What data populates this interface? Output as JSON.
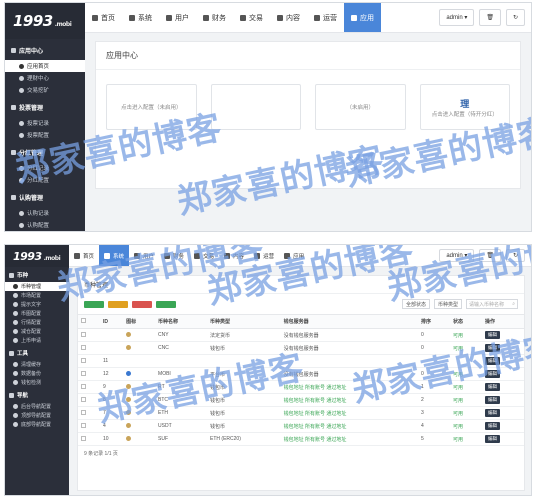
{
  "brand": {
    "logo": "1993",
    "logo_suffix": ".mobi"
  },
  "nav_tabs": [
    {
      "label": "首页",
      "icon": "home-icon"
    },
    {
      "label": "系统",
      "icon": "gear-icon"
    },
    {
      "label": "用户",
      "icon": "user-icon"
    },
    {
      "label": "财务",
      "icon": "list-icon"
    },
    {
      "label": "交易",
      "icon": "exchange-icon"
    },
    {
      "label": "内容",
      "icon": "document-icon"
    },
    {
      "label": "运营",
      "icon": "globe-icon"
    },
    {
      "label": "应用",
      "icon": "grid-icon"
    }
  ],
  "top_right": {
    "user": "admin ▾",
    "trash": "🗑",
    "refresh": "↻"
  },
  "sidebar1": {
    "groups": [
      {
        "title": "应用中心",
        "items": [
          "应用首页",
          "理财中心",
          "交易挖矿"
        ]
      },
      {
        "title": "投票管理",
        "items": [
          "投票记录",
          "投票配置"
        ]
      },
      {
        "title": "分红管理",
        "items": [
          "分红记录",
          "分红配置"
        ]
      },
      {
        "title": "认购管理",
        "items": [
          "认购记录",
          "认购配置"
        ]
      }
    ]
  },
  "content1": {
    "title": "应用中心",
    "cards": [
      "点击进入配置（未启用）",
      "",
      "（未启用）",
      "点击进入配置（待开分红）"
    ],
    "card4_bold": "理"
  },
  "sidebar2": {
    "groups": [
      {
        "title": "币种",
        "items": [
          "币种管理",
          "市场配置",
          "提示文字",
          "币图配置",
          "行情配置",
          "减仓配置",
          "上币申请"
        ]
      },
      {
        "title": "工具",
        "items": [
          "清理缓存",
          "数据备份",
          "钱包检测"
        ]
      },
      {
        "title": "导航",
        "items": [
          "后台导航配置",
          "顶部导航配置",
          "底部导航配置"
        ]
      }
    ]
  },
  "content2": {
    "title": "币种管理",
    "filters": {
      "status": "全部状态",
      "type": "币种类型",
      "search": "请输入币种名称"
    },
    "columns": [
      "ID",
      "图标",
      "币种名称",
      "币种类型",
      "钱包服务器",
      "排序",
      "状态",
      "操作"
    ],
    "rows": [
      {
        "id": "",
        "name": "CNY",
        "type": "法定货币",
        "server": "没有钱包服务器",
        "sort": "0",
        "status": "可用",
        "action": "编辑"
      },
      {
        "id": "",
        "name": "CNC",
        "type": "钱包币",
        "server": "没有钱包服务器",
        "sort": "0",
        "status": "可用",
        "action": "编辑"
      },
      {
        "id": "11",
        "name": "",
        "type": "",
        "server": "",
        "sort": "",
        "status": "",
        "action": "编辑"
      },
      {
        "id": "12",
        "name": "MOBI",
        "type": "平台币",
        "server": "没有钱包服务器",
        "sort": "0",
        "status": "可用",
        "action": "编辑"
      },
      {
        "id": "9",
        "name": "RT",
        "type": "钱包币",
        "server": "钱包地址 所有账号 通过地址",
        "sort": "1",
        "status": "可用",
        "action": "编辑"
      },
      {
        "id": "8",
        "name": "BTC",
        "type": "钱包币",
        "server": "钱包地址 所有账号 通过地址",
        "sort": "2",
        "status": "可用",
        "action": "编辑"
      },
      {
        "id": "7",
        "name": "ETH",
        "type": "钱包币",
        "server": "钱包地址 所有账号 通过地址",
        "sort": "3",
        "status": "可用",
        "action": "编辑"
      },
      {
        "id": "4",
        "name": "USDT",
        "type": "钱包币",
        "server": "钱包地址 所有账号 通过地址",
        "sort": "4",
        "status": "可用",
        "action": "编辑"
      },
      {
        "id": "10",
        "name": "SUF",
        "type": "ETH (ERC20)",
        "server": "钱包地址 所有账号 通过地址",
        "sort": "5",
        "status": "可用",
        "action": "编辑"
      }
    ],
    "footer": "9 条记录 1/1 页"
  },
  "watermark": "郑家喜的博客",
  "colors": {
    "accent": "#4a86d9",
    "sidebar": "#2b2f3a",
    "status_green": "#3aa655",
    "edit_button": "#2f3b4c"
  }
}
